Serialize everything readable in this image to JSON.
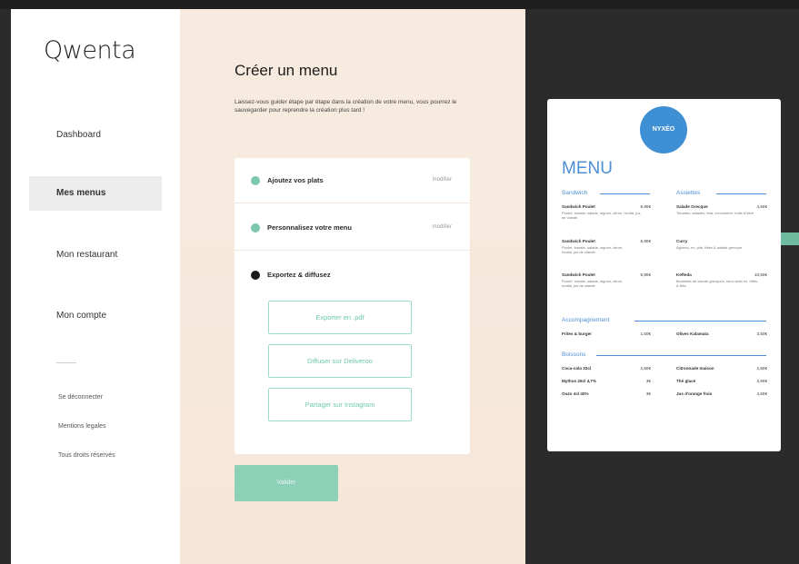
{
  "brand": {
    "logo_text": "Qwenta"
  },
  "sidebar": {
    "items": [
      {
        "label": "Dashboard",
        "active": false
      },
      {
        "label": "Mes menus",
        "active": true
      },
      {
        "label": "Mon restaurant",
        "active": false
      },
      {
        "label": "Mon compte",
        "active": false
      }
    ],
    "footer_links": [
      "Se déconnecter",
      "Mentions legales",
      "Tous droits réservés"
    ]
  },
  "main": {
    "title": "Créer un menu",
    "description": "Laissez-vous guider étape par étape dans la création de votre menu, vous pourrez le sauvegarder pour reprendre la création plus tard !",
    "steps": [
      {
        "label": "Ajoutez vos plats",
        "modify": "modifier",
        "state": "done"
      },
      {
        "label": "Personnalisez votre menu",
        "modify": "modifier",
        "state": "done"
      },
      {
        "label": "Exportez & diffusez",
        "modify": "",
        "state": "current"
      }
    ],
    "actions": [
      "Exporter en .pdf",
      "Diffuser sur Deliveroo",
      "Partager sur Instagram"
    ],
    "submit_label": "Valider"
  },
  "preview": {
    "logo_text": "NYXÉO",
    "title": "MENU",
    "sections": [
      {
        "name": "Sandwich",
        "items": [
          {
            "name": "Sandwich Poulet",
            "price": "6,90€",
            "desc": "Poulet, tomate, salade, oignon, citron, ricotta, jus de viande"
          },
          {
            "name": "Sandwich Poulet",
            "price": "6,90€",
            "desc": "Poulet, tomate, salade, oignon, citron, ricotta, jus de viande"
          },
          {
            "name": "Sandwich Poulet",
            "price": "6,90€",
            "desc": "Poulet, tomate, salade, oignon, citron, ricotta, jus de viande"
          }
        ]
      },
      {
        "name": "Assiettes",
        "items": [
          {
            "name": "Salade Grecque",
            "price": "4,50€",
            "desc": "Tomates, salades, feta, concombre, huile d'olive"
          },
          {
            "name": "Curry",
            "price": "",
            "desc": "Agneau, riz, pita, frites & salade grecque"
          },
          {
            "name": "Kefteda",
            "price": "10,50€",
            "desc": "Boulettes de viande grecques, servi avec riz, frites & feta"
          }
        ]
      },
      {
        "name": "Accompagnement",
        "items": [
          {
            "name": "Frites & burger",
            "price": "1,50€",
            "desc": ""
          },
          {
            "name": "Olives Kalamata",
            "price": "3,50€",
            "desc": ""
          }
        ]
      },
      {
        "name": "Boissons",
        "items": [
          {
            "name": "Coca-cola 33cl",
            "price": "2,50€",
            "desc": ""
          },
          {
            "name": "Mythos 25cl 4,7%",
            "price": "3€",
            "desc": ""
          },
          {
            "name": "Ouzo 4cl 40%",
            "price": "3€",
            "desc": ""
          },
          {
            "name": "Citronnade maison",
            "price": "2,50€",
            "desc": ""
          },
          {
            "name": "Thé glacé",
            "price": "3,50€",
            "desc": ""
          },
          {
            "name": "Jus d'orange frais",
            "price": "4,50€",
            "desc": ""
          }
        ]
      }
    ]
  },
  "colors": {
    "accent": "#8dd0b8",
    "brand_blue": "#4d8ed5",
    "panel": "#f6e6d8"
  }
}
